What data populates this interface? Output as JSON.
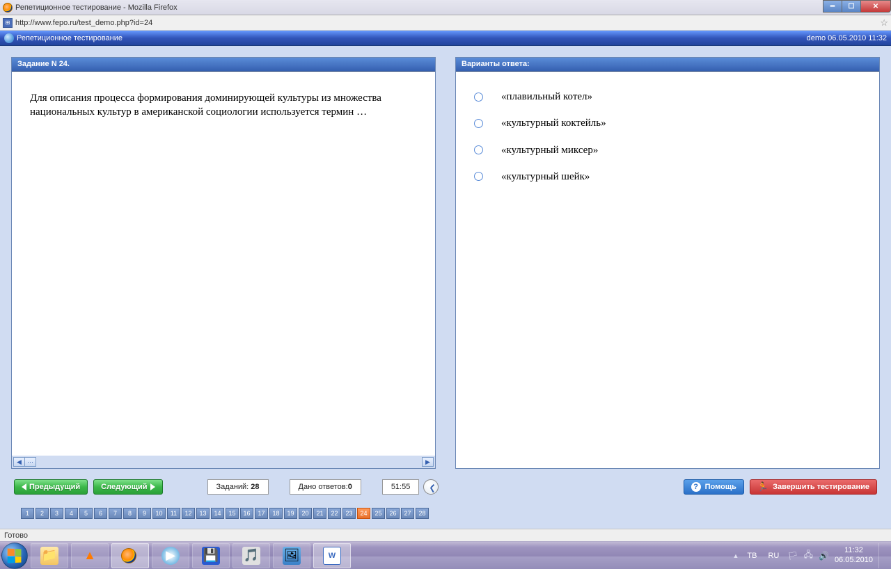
{
  "window": {
    "title": "Репетиционное тестирование - Mozilla Firefox"
  },
  "url": "http://www.fepo.ru/test_demo.php?id=24",
  "app_header": {
    "title": "Репетиционное тестирование",
    "right": "demo 06.05.2010 11:32"
  },
  "question_panel": {
    "header": "Задание N 24.",
    "text": "Для описания процесса формирования доминирующей культуры из множества национальных культур в американской социологии используется термин …"
  },
  "answers_panel": {
    "header": "Варианты ответа:",
    "options": [
      "«плавильный котел»",
      "«культурный коктейль»",
      "«культурный миксер»",
      "«культурный шейк»"
    ]
  },
  "toolbar": {
    "prev": "Предыдущий",
    "next": "Следующий",
    "tasks_label": "Заданий:",
    "tasks_count": "28",
    "answered_label": "Дано ответов:",
    "answered_count": "0",
    "time": "51:55",
    "help": "Помощь",
    "finish": "Завершить тестирование"
  },
  "pager": {
    "total": 28,
    "current": 24
  },
  "status_bar": "Готово",
  "tray": {
    "tb": "ТВ",
    "lang": "RU",
    "time": "11:32",
    "date": "06.05.2010"
  }
}
